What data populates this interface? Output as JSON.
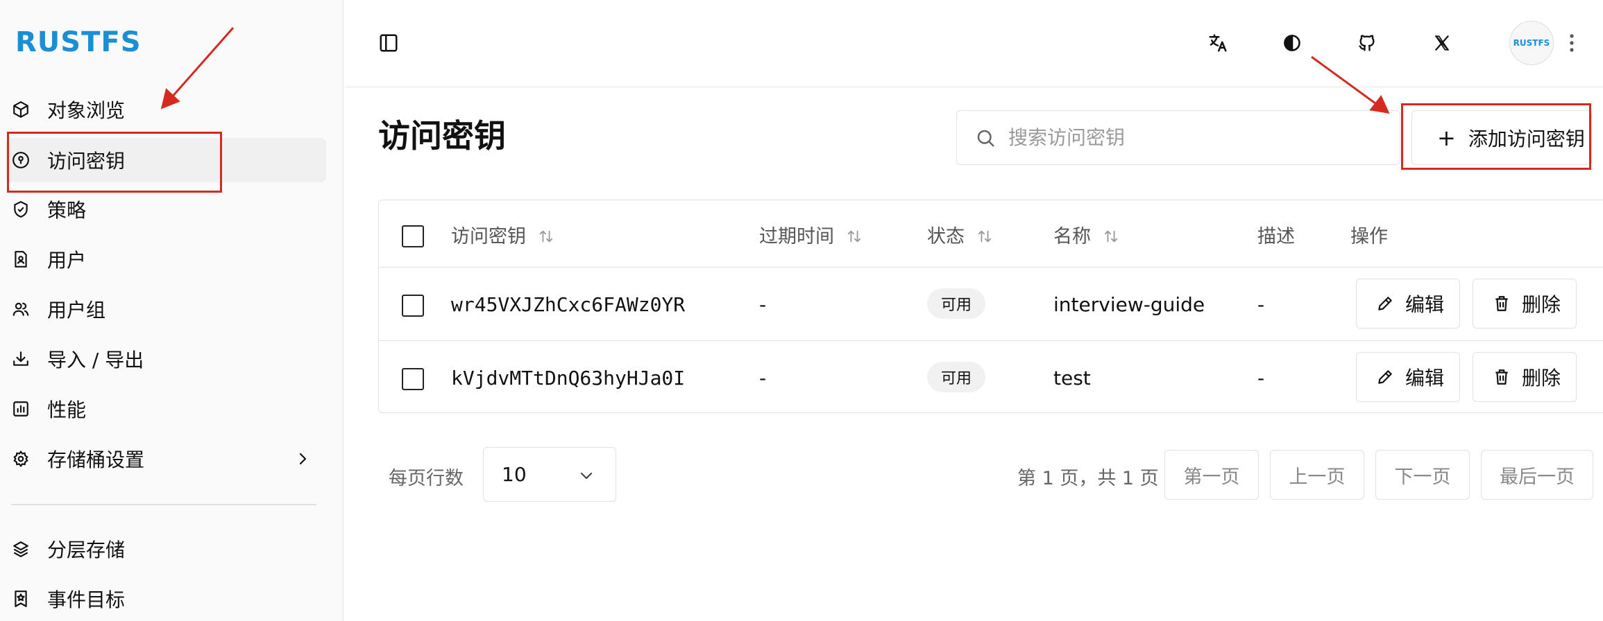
{
  "sidebar": {
    "logo": "RUSTFS",
    "items": [
      {
        "label": "对象浏览",
        "icon": "box-icon"
      },
      {
        "label": "访问密钥",
        "icon": "key-circle-icon"
      },
      {
        "label": "策略",
        "icon": "shield-check-icon"
      },
      {
        "label": "用户",
        "icon": "user-badge-icon"
      },
      {
        "label": "用户组",
        "icon": "users-icon"
      },
      {
        "label": "导入 / 导出",
        "icon": "download-icon"
      },
      {
        "label": "性能",
        "icon": "chart-icon"
      },
      {
        "label": "存储桶设置",
        "icon": "gear-icon"
      }
    ],
    "secondary_items": [
      {
        "label": "分层存储",
        "icon": "layers-icon"
      },
      {
        "label": "事件目标",
        "icon": "bookmark-star-icon"
      }
    ],
    "active": "访问密钥"
  },
  "topbar": {
    "avatar_text": "RUSTFS"
  },
  "page": {
    "title": "访问密钥",
    "search_placeholder": "搜索访问密钥",
    "add_button": "添加访问密钥"
  },
  "table": {
    "headers": {
      "key": "访问密钥",
      "expiry": "过期时间",
      "status": "状态",
      "name": "名称",
      "description": "描述",
      "actions": "操作"
    },
    "rows": [
      {
        "key": "wr45VXJZhCxc6FAWz0YR",
        "expiry": "-",
        "status": "可用",
        "name": "interview-guide",
        "description": "-",
        "edit": "编辑",
        "delete": "删除"
      },
      {
        "key": "kVjdvMTtDnQ63hyHJa0I",
        "expiry": "-",
        "status": "可用",
        "name": "test",
        "description": "-",
        "edit": "编辑",
        "delete": "删除"
      }
    ]
  },
  "pagination": {
    "rows_per_page_label": "每页行数",
    "rows_per_page_value": "10",
    "page_info": "第 1 页，共 1 页",
    "first": "第一页",
    "prev": "上一页",
    "next": "下一页",
    "last": "最后一页"
  },
  "colors": {
    "brand": "#1a8fd6",
    "annotation": "#d42a20"
  }
}
